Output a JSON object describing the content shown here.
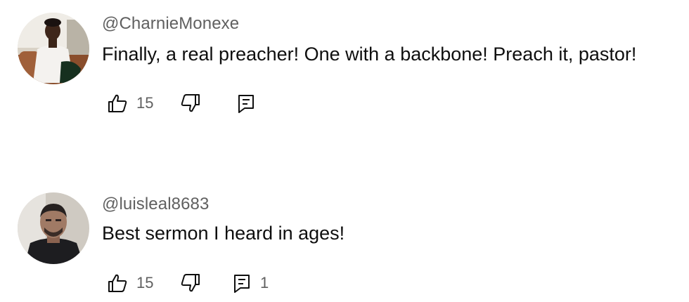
{
  "comments": [
    {
      "author": "@CharnieMonexe",
      "text": "Finally, a real preacher! One with a backbone! Preach it, pastor!",
      "likes": "15",
      "replies": ""
    },
    {
      "author": "@luisleal8683",
      "text": "Best sermon I heard in ages!",
      "likes": "15",
      "replies": "1"
    }
  ],
  "icons": {
    "like": "thumbs-up-icon",
    "dislike": "thumbs-down-icon",
    "reply": "reply-icon"
  },
  "colors": {
    "author": "#606060",
    "text": "#0f0f0f",
    "icon": "#0f0f0f"
  }
}
